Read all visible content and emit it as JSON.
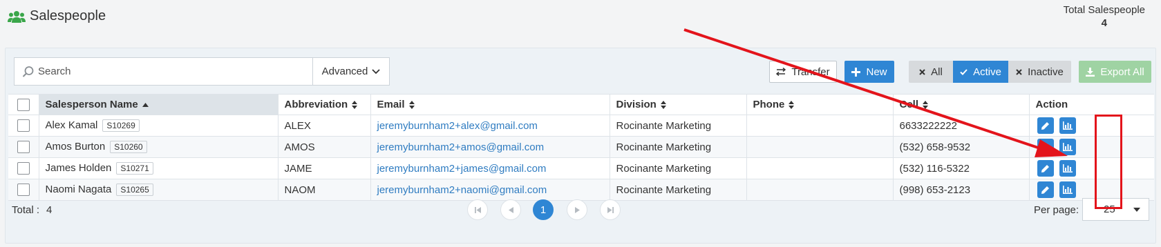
{
  "header": {
    "title": "Salespeople",
    "total_label": "Total Salespeople",
    "total_value": "4"
  },
  "toolbar": {
    "search_placeholder": "Search",
    "advanced_label": "Advanced",
    "transfer_label": "Transfer",
    "new_label": "New",
    "filter_all_label": "All",
    "filter_active_label": "Active",
    "filter_inactive_label": "Inactive",
    "export_label": "Export All",
    "active_filter": "Active"
  },
  "table": {
    "columns": [
      "Salesperson Name",
      "Abbreviation",
      "Email",
      "Division",
      "Phone",
      "Cell",
      "Action"
    ],
    "rows": [
      {
        "name": "Alex Kamal",
        "code": "S10269",
        "abbr": "ALEX",
        "email": "jeremyburnham2+alex@gmail.com",
        "division": "Rocinante Marketing",
        "phone": "",
        "cell": "6633222222"
      },
      {
        "name": "Amos Burton",
        "code": "S10260",
        "abbr": "AMOS",
        "email": "jeremyburnham2+amos@gmail.com",
        "division": "Rocinante Marketing",
        "phone": "",
        "cell": "(532) 658-9532"
      },
      {
        "name": "James Holden",
        "code": "S10271",
        "abbr": "JAME",
        "email": "jeremyburnham2+james@gmail.com",
        "division": "Rocinante Marketing",
        "phone": "",
        "cell": "(532) 116-5322"
      },
      {
        "name": "Naomi Nagata",
        "code": "S10265",
        "abbr": "NAOM",
        "email": "jeremyburnham2+naomi@gmail.com",
        "division": "Rocinante Marketing",
        "phone": "",
        "cell": "(998) 653-2123"
      }
    ]
  },
  "footer": {
    "total_label": "Total :",
    "total_value": "4",
    "current_page": "1",
    "per_page_label": "Per page:",
    "per_page_value": "25"
  },
  "colors": {
    "primary": "#2f86d4",
    "export": "#9fd3a3",
    "annotation": "#e3141b",
    "title_icon": "#3aa64a"
  },
  "icons": [
    "users-icon",
    "search-icon",
    "chevron-down-icon",
    "transfer-icon",
    "plus-icon",
    "close-icon",
    "check-icon",
    "download-icon",
    "sort-icon",
    "pencil-icon",
    "chart-icon",
    "first-page-icon",
    "prev-page-icon",
    "next-page-icon",
    "last-page-icon"
  ]
}
